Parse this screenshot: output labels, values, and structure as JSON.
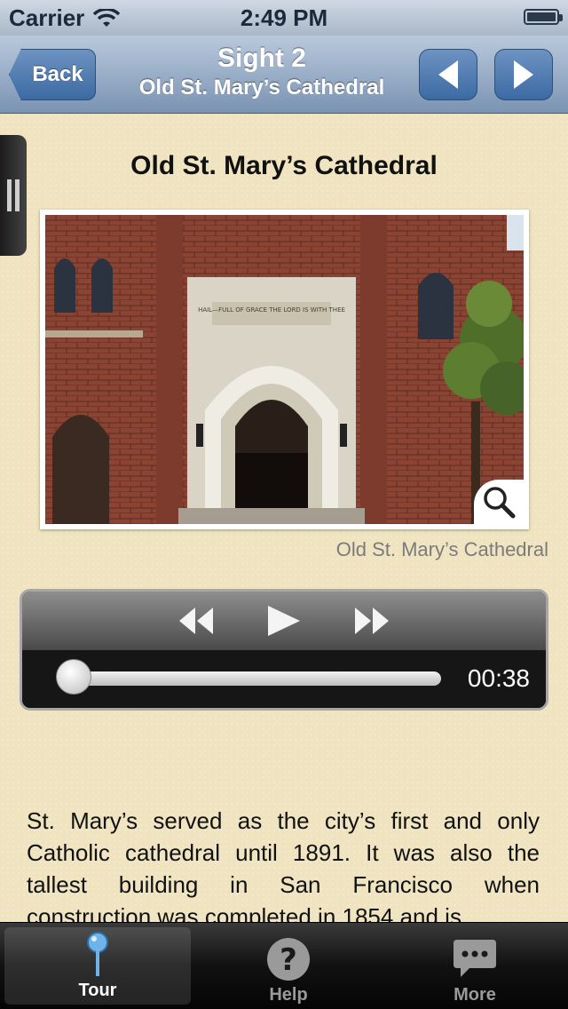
{
  "status_bar": {
    "carrier": "Carrier",
    "time": "2:49 PM"
  },
  "nav": {
    "back_label": "Back",
    "title": "Sight 2",
    "subtitle": "Old St. Mary’s Cathedral"
  },
  "sight": {
    "heading": "Old St. Mary’s Cathedral",
    "photo_sign": "HAIL—FULL OF GRACE THE LORD IS WITH THEE",
    "photo_caption": "Old St. Mary’s Cathedral",
    "description": "St. Mary’s served as the city’s first and only Catholic cathedral until 1891. It was also the tallest building in San Francisco when construction was completed in 1854 and is"
  },
  "player": {
    "elapsed": "00:38",
    "progress": 0.0
  },
  "tabs": [
    {
      "label": "Tour",
      "icon": "map-pin-icon",
      "active": true
    },
    {
      "label": "Help",
      "icon": "question-icon",
      "active": false
    },
    {
      "label": "More",
      "icon": "chat-bubble-icon",
      "active": false
    }
  ],
  "colors": {
    "nav_blue": "#3b6aa3",
    "parchment": "#efe3c0",
    "tour_icon": "#5aa0e0"
  }
}
